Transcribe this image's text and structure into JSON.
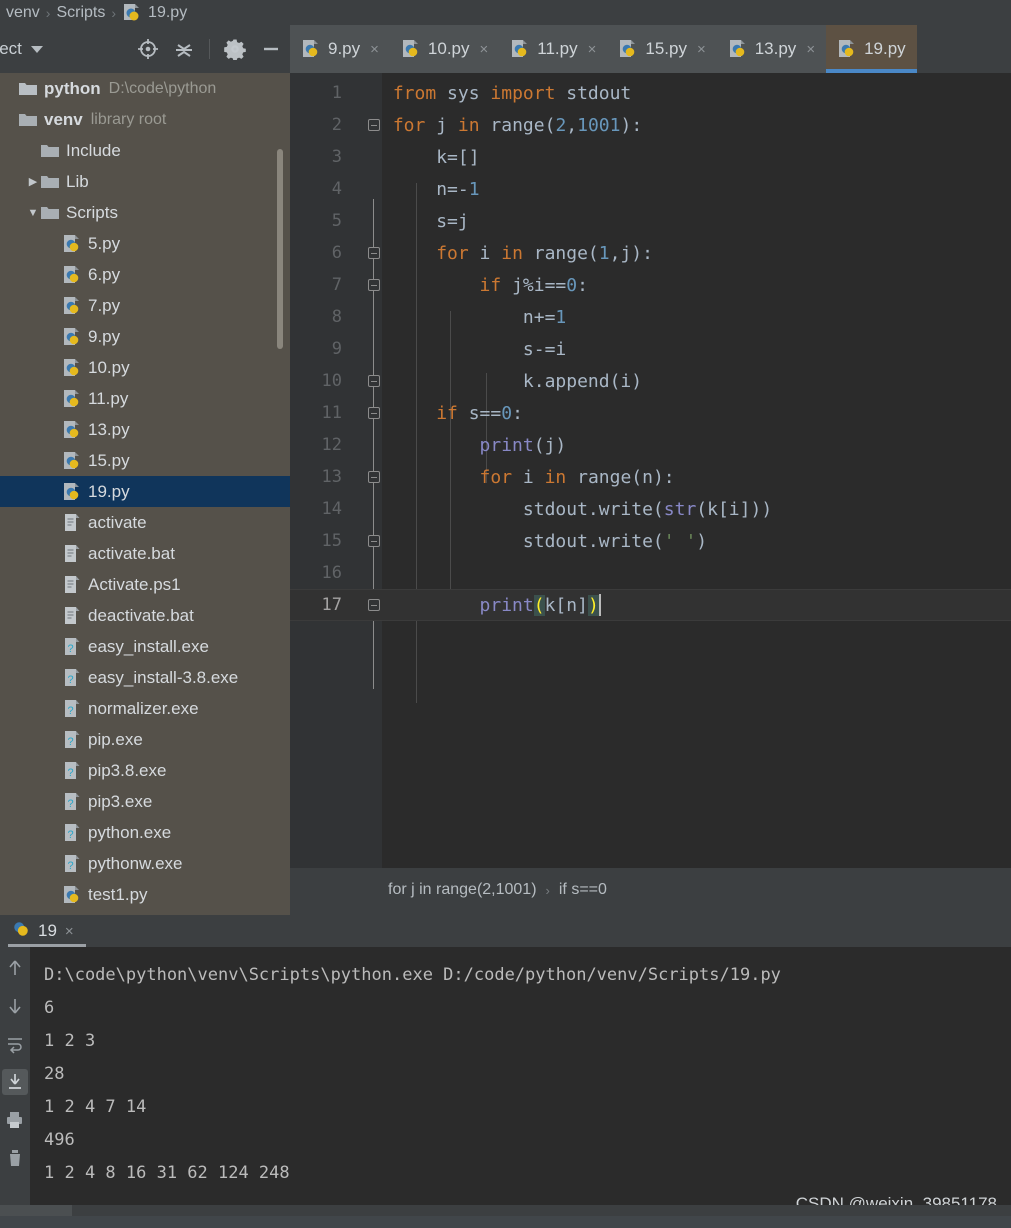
{
  "breadcrumb_top": {
    "items": [
      "venv",
      "Scripts",
      "19.py"
    ],
    "file_icon": "python-file-icon"
  },
  "project_panel": {
    "title": "oject",
    "caret": "chevron-down-icon",
    "tools": [
      "locate-crosshair-icon",
      "collapse-all-icon",
      "settings-gear-icon",
      "hide-minimize-icon"
    ],
    "tree": [
      {
        "label": "python",
        "detail": "D:\\code\\python",
        "icon": "project-root-icon",
        "indent": 0,
        "arrow": "",
        "bold": true,
        "selected": false
      },
      {
        "label": "venv",
        "detail": "library root",
        "icon": "folder-icon",
        "indent": 0,
        "arrow": "",
        "bold": true,
        "selected": false
      },
      {
        "label": "Include",
        "detail": "",
        "icon": "folder-icon",
        "indent": 1,
        "arrow": "",
        "bold": false,
        "selected": false
      },
      {
        "label": "Lib",
        "detail": "",
        "icon": "folder-icon",
        "indent": 1,
        "arrow": "▶",
        "bold": false,
        "selected": false
      },
      {
        "label": "Scripts",
        "detail": "",
        "icon": "folder-icon",
        "indent": 1,
        "arrow": "▼",
        "bold": false,
        "selected": false
      },
      {
        "label": "5.py",
        "detail": "",
        "icon": "python-file-icon",
        "indent": 2,
        "arrow": "",
        "bold": false,
        "selected": false
      },
      {
        "label": "6.py",
        "detail": "",
        "icon": "python-file-icon",
        "indent": 2,
        "arrow": "",
        "bold": false,
        "selected": false
      },
      {
        "label": "7.py",
        "detail": "",
        "icon": "python-file-icon",
        "indent": 2,
        "arrow": "",
        "bold": false,
        "selected": false
      },
      {
        "label": "9.py",
        "detail": "",
        "icon": "python-file-icon",
        "indent": 2,
        "arrow": "",
        "bold": false,
        "selected": false
      },
      {
        "label": "10.py",
        "detail": "",
        "icon": "python-file-icon",
        "indent": 2,
        "arrow": "",
        "bold": false,
        "selected": false
      },
      {
        "label": "11.py",
        "detail": "",
        "icon": "python-file-icon",
        "indent": 2,
        "arrow": "",
        "bold": false,
        "selected": false
      },
      {
        "label": "13.py",
        "detail": "",
        "icon": "python-file-icon",
        "indent": 2,
        "arrow": "",
        "bold": false,
        "selected": false
      },
      {
        "label": "15.py",
        "detail": "",
        "icon": "python-file-icon",
        "indent": 2,
        "arrow": "",
        "bold": false,
        "selected": false
      },
      {
        "label": "19.py",
        "detail": "",
        "icon": "python-file-icon",
        "indent": 2,
        "arrow": "",
        "bold": false,
        "selected": true
      },
      {
        "label": "activate",
        "detail": "",
        "icon": "text-file-icon",
        "indent": 2,
        "arrow": "",
        "bold": false,
        "selected": false
      },
      {
        "label": "activate.bat",
        "detail": "",
        "icon": "text-file-icon",
        "indent": 2,
        "arrow": "",
        "bold": false,
        "selected": false
      },
      {
        "label": "Activate.ps1",
        "detail": "",
        "icon": "text-file-icon",
        "indent": 2,
        "arrow": "",
        "bold": false,
        "selected": false
      },
      {
        "label": "deactivate.bat",
        "detail": "",
        "icon": "text-file-icon",
        "indent": 2,
        "arrow": "",
        "bold": false,
        "selected": false
      },
      {
        "label": "easy_install.exe",
        "detail": "",
        "icon": "unknown-file-icon",
        "indent": 2,
        "arrow": "",
        "bold": false,
        "selected": false
      },
      {
        "label": "easy_install-3.8.exe",
        "detail": "",
        "icon": "unknown-file-icon",
        "indent": 2,
        "arrow": "",
        "bold": false,
        "selected": false
      },
      {
        "label": "normalizer.exe",
        "detail": "",
        "icon": "unknown-file-icon",
        "indent": 2,
        "arrow": "",
        "bold": false,
        "selected": false
      },
      {
        "label": "pip.exe",
        "detail": "",
        "icon": "unknown-file-icon",
        "indent": 2,
        "arrow": "",
        "bold": false,
        "selected": false
      },
      {
        "label": "pip3.8.exe",
        "detail": "",
        "icon": "unknown-file-icon",
        "indent": 2,
        "arrow": "",
        "bold": false,
        "selected": false
      },
      {
        "label": "pip3.exe",
        "detail": "",
        "icon": "unknown-file-icon",
        "indent": 2,
        "arrow": "",
        "bold": false,
        "selected": false
      },
      {
        "label": "python.exe",
        "detail": "",
        "icon": "unknown-file-icon",
        "indent": 2,
        "arrow": "",
        "bold": false,
        "selected": false
      },
      {
        "label": "pythonw.exe",
        "detail": "",
        "icon": "unknown-file-icon",
        "indent": 2,
        "arrow": "",
        "bold": false,
        "selected": false
      },
      {
        "label": "test1.py",
        "detail": "",
        "icon": "python-file-icon",
        "indent": 2,
        "arrow": "",
        "bold": false,
        "selected": false
      }
    ]
  },
  "editor_tabs": [
    {
      "label": "9.py",
      "close": "×",
      "active": false
    },
    {
      "label": "10.py",
      "close": "×",
      "active": false
    },
    {
      "label": "11.py",
      "close": "×",
      "active": false
    },
    {
      "label": "15.py",
      "close": "×",
      "active": false
    },
    {
      "label": "13.py",
      "close": "×",
      "active": false
    },
    {
      "label": "19.py",
      "close": "",
      "active": true
    }
  ],
  "code": {
    "lines": [
      {
        "n": "1",
        "indent": 0,
        "tokens": [
          {
            "t": "from ",
            "c": "kw"
          },
          {
            "t": "sys ",
            "c": "txt"
          },
          {
            "t": "import ",
            "c": "kw"
          },
          {
            "t": "stdout",
            "c": "txt"
          }
        ],
        "fold": false
      },
      {
        "n": "2",
        "indent": 0,
        "tokens": [
          {
            "t": "for ",
            "c": "kw"
          },
          {
            "t": "j ",
            "c": "txt"
          },
          {
            "t": "in ",
            "c": "kw"
          },
          {
            "t": "range(",
            "c": "txt"
          },
          {
            "t": "2",
            "c": "num"
          },
          {
            "t": ",",
            "c": "txt"
          },
          {
            "t": "1001",
            "c": "num"
          },
          {
            "t": "):",
            "c": "txt"
          }
        ],
        "fold": true
      },
      {
        "n": "3",
        "indent": 1,
        "tokens": [
          {
            "t": "k=[]",
            "c": "txt"
          }
        ],
        "fold": false
      },
      {
        "n": "4",
        "indent": 1,
        "tokens": [
          {
            "t": "n=-",
            "c": "txt"
          },
          {
            "t": "1",
            "c": "num"
          }
        ],
        "fold": false
      },
      {
        "n": "5",
        "indent": 1,
        "tokens": [
          {
            "t": "s=j",
            "c": "txt"
          }
        ],
        "fold": false
      },
      {
        "n": "6",
        "indent": 1,
        "tokens": [
          {
            "t": "for ",
            "c": "kw"
          },
          {
            "t": "i ",
            "c": "txt"
          },
          {
            "t": "in ",
            "c": "kw"
          },
          {
            "t": "range(",
            "c": "txt"
          },
          {
            "t": "1",
            "c": "num"
          },
          {
            "t": ",j):",
            "c": "txt"
          }
        ],
        "fold": true
      },
      {
        "n": "7",
        "indent": 2,
        "tokens": [
          {
            "t": "if ",
            "c": "kw"
          },
          {
            "t": "j%i==",
            "c": "txt"
          },
          {
            "t": "0",
            "c": "num"
          },
          {
            "t": ":",
            "c": "txt"
          }
        ],
        "fold": true
      },
      {
        "n": "8",
        "indent": 3,
        "tokens": [
          {
            "t": "n+=",
            "c": "txt"
          },
          {
            "t": "1",
            "c": "num"
          }
        ],
        "fold": false
      },
      {
        "n": "9",
        "indent": 3,
        "tokens": [
          {
            "t": "s-=i",
            "c": "txt"
          }
        ],
        "fold": false
      },
      {
        "n": "10",
        "indent": 3,
        "tokens": [
          {
            "t": "k.append(i)",
            "c": "txt"
          }
        ],
        "fold": true
      },
      {
        "n": "11",
        "indent": 1,
        "tokens": [
          {
            "t": "if ",
            "c": "kw"
          },
          {
            "t": "s==",
            "c": "txt"
          },
          {
            "t": "0",
            "c": "num"
          },
          {
            "t": ":",
            "c": "txt"
          }
        ],
        "fold": true
      },
      {
        "n": "12",
        "indent": 2,
        "tokens": [
          {
            "t": "print",
            "c": "fn"
          },
          {
            "t": "(j)",
            "c": "txt"
          }
        ],
        "fold": false
      },
      {
        "n": "13",
        "indent": 2,
        "tokens": [
          {
            "t": "for ",
            "c": "kw"
          },
          {
            "t": "i ",
            "c": "txt"
          },
          {
            "t": "in ",
            "c": "kw"
          },
          {
            "t": "range(n):",
            "c": "txt"
          }
        ],
        "fold": true
      },
      {
        "n": "14",
        "indent": 3,
        "tokens": [
          {
            "t": "stdout.write(",
            "c": "txt"
          },
          {
            "t": "str",
            "c": "fn"
          },
          {
            "t": "(k[i]))",
            "c": "txt"
          }
        ],
        "fold": false
      },
      {
        "n": "15",
        "indent": 3,
        "tokens": [
          {
            "t": "stdout.write(",
            "c": "txt"
          },
          {
            "t": "' '",
            "c": "str"
          },
          {
            "t": ")",
            "c": "txt"
          }
        ],
        "fold": true
      },
      {
        "n": "16",
        "indent": 0,
        "tokens": [],
        "fold": false
      },
      {
        "n": "17",
        "indent": 2,
        "tokens": [
          {
            "t": "print",
            "c": "fn"
          },
          {
            "t": "(",
            "c": "paren-hl"
          },
          {
            "t": "k[n]",
            "c": "txt"
          },
          {
            "t": ")",
            "c": "paren-hl"
          }
        ],
        "fold": true,
        "current": true,
        "caret": true
      }
    ]
  },
  "editor_breadcrumb": {
    "items": [
      "for j in range(2,1001)",
      "if s==0"
    ],
    "separator": "›"
  },
  "console": {
    "tab_label": "19",
    "tab_icon": "python-icon",
    "tab_close": "×",
    "side_tools": [
      {
        "icon": "arrow-up-icon",
        "active": false
      },
      {
        "icon": "arrow-down-icon",
        "active": false
      },
      {
        "icon": "soft-wrap-icon",
        "active": false
      },
      {
        "icon": "scroll-to-end-icon",
        "active": true
      },
      {
        "icon": "print-icon",
        "active": false
      },
      {
        "icon": "trash-icon",
        "active": false
      }
    ],
    "output": [
      "D:\\code\\python\\venv\\Scripts\\python.exe D:/code/python/venv/Scripts/19.py",
      "6",
      "1 2 3",
      "28",
      "1 2 4 7 14",
      "496",
      "1 2 4 8 16 31 62 124 248"
    ]
  },
  "watermark": "CSDN @weixin_39851178",
  "colors": {
    "accent_blue": "#4a88c7",
    "sidebar_bg": "#55514a",
    "editor_bg": "#2b2b2b",
    "panel_bg": "#3c3f41",
    "selection_blue": "#10355b",
    "keyword_orange": "#cc7832",
    "number_blue": "#6897bb",
    "string_green": "#6a8759",
    "function_purple": "#8888c6"
  }
}
